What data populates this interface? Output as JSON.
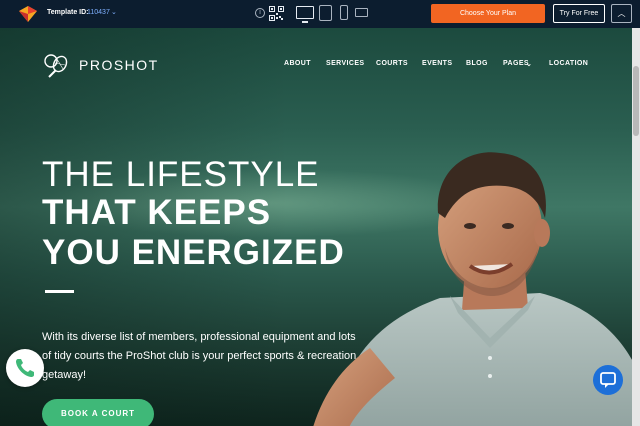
{
  "topbar": {
    "template_label": "Template ID:",
    "template_id": "110437",
    "choose_plan_label": "Choose Your Plan",
    "try_free_label": "Try For Free",
    "colors": {
      "background": "#0c1d2f",
      "accent": "#f26522"
    }
  },
  "site": {
    "brand": "PROSHOT",
    "nav": [
      "ABOUT",
      "SERVICES",
      "COURTS",
      "EVENTS",
      "BLOG",
      "PAGES",
      "LOCATION"
    ]
  },
  "hero": {
    "line1": "THE LIFESTYLE",
    "line2": "THAT KEEPS",
    "line3": "YOU ENERGIZED",
    "description": "With its diverse list of members, professional equipment and lots of tidy courts the ProShot club is your perfect sports & recreation getaway!",
    "cta": "BOOK A COURT",
    "colors": {
      "cta": "#3fb878"
    }
  },
  "icons": {
    "phone": "phone-icon",
    "chat": "chat-icon",
    "info": "info-icon",
    "qr": "qr-code-icon"
  }
}
